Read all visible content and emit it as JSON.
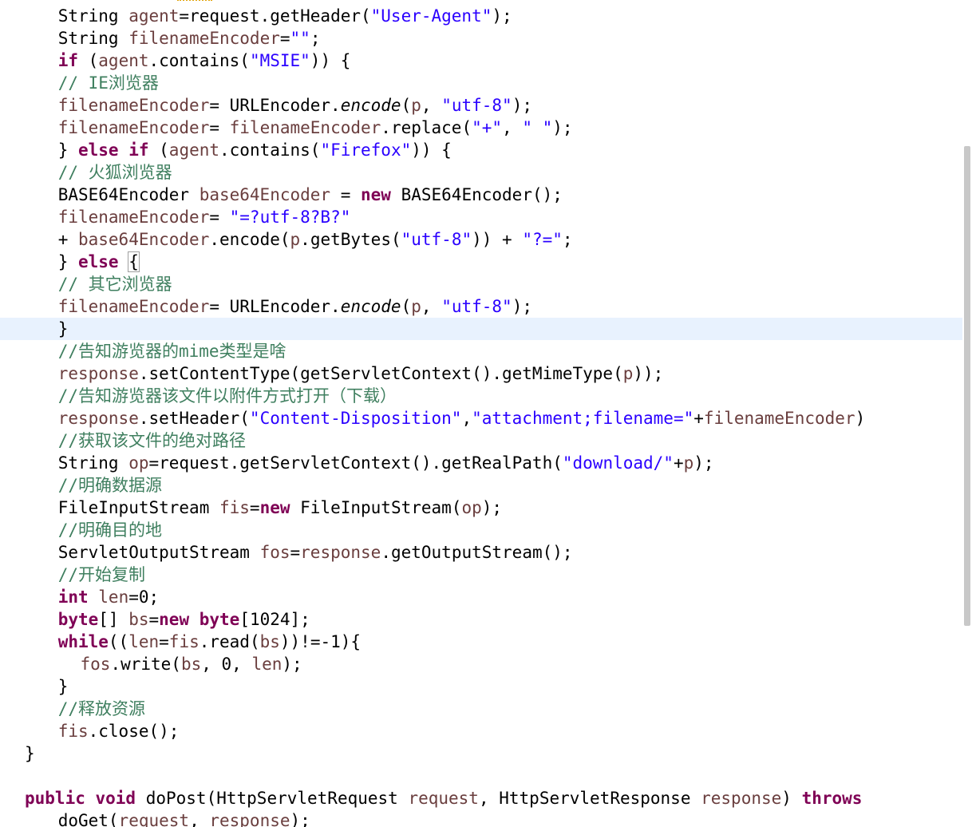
{
  "editor": {
    "lines": [
      {
        "indent": 4,
        "tokens": [
          [
            "plain",
            "String "
          ],
          [
            "field",
            "agent"
          ],
          [
            "plain",
            "=request.getHeader("
          ],
          [
            "string",
            "\"User-Agent\""
          ],
          [
            "plain",
            ");"
          ]
        ]
      },
      {
        "indent": 4,
        "tokens": [
          [
            "plain",
            "String "
          ],
          [
            "field",
            "filenameEncoder"
          ],
          [
            "plain",
            "="
          ],
          [
            "string",
            "\"\""
          ],
          [
            "plain",
            ";"
          ]
        ]
      },
      {
        "indent": 4,
        "tokens": [
          [
            "keyword",
            "if"
          ],
          [
            "plain",
            " ("
          ],
          [
            "field",
            "agent"
          ],
          [
            "plain",
            ".contains("
          ],
          [
            "string",
            "\"MSIE\""
          ],
          [
            "plain",
            ")) {"
          ]
        ]
      },
      {
        "indent": 4,
        "tokens": [
          [
            "comment",
            "// IE浏览器"
          ]
        ]
      },
      {
        "indent": 4,
        "tokens": [
          [
            "field",
            "filenameEncoder"
          ],
          [
            "plain",
            "= URLEncoder."
          ],
          [
            "italic",
            "encode"
          ],
          [
            "plain",
            "("
          ],
          [
            "field",
            "p"
          ],
          [
            "plain",
            ", "
          ],
          [
            "string",
            "\"utf-8\""
          ],
          [
            "plain",
            ");"
          ]
        ]
      },
      {
        "indent": 4,
        "tokens": [
          [
            "field",
            "filenameEncoder"
          ],
          [
            "plain",
            "= "
          ],
          [
            "field",
            "filenameEncoder"
          ],
          [
            "plain",
            ".replace("
          ],
          [
            "string",
            "\"+\""
          ],
          [
            "plain",
            ", "
          ],
          [
            "string",
            "\" \""
          ],
          [
            "plain",
            ");"
          ]
        ]
      },
      {
        "indent": 4,
        "tokens": [
          [
            "plain",
            "} "
          ],
          [
            "keyword",
            "else if"
          ],
          [
            "plain",
            " ("
          ],
          [
            "field",
            "agent"
          ],
          [
            "plain",
            ".contains("
          ],
          [
            "string",
            "\"Firefox\""
          ],
          [
            "plain",
            ")) {"
          ]
        ]
      },
      {
        "indent": 4,
        "tokens": [
          [
            "comment",
            "// 火狐浏览器"
          ]
        ]
      },
      {
        "indent": 4,
        "tokens": [
          [
            "plain",
            "BASE64Encoder "
          ],
          [
            "field",
            "base64Encoder"
          ],
          [
            "plain",
            " = "
          ],
          [
            "keyword",
            "new"
          ],
          [
            "plain",
            " BASE64Encoder();"
          ]
        ]
      },
      {
        "indent": 4,
        "tokens": [
          [
            "field",
            "filenameEncoder"
          ],
          [
            "plain",
            "= "
          ],
          [
            "string",
            "\"=?utf-8?B?\""
          ]
        ]
      },
      {
        "indent": 4,
        "tokens": [
          [
            "plain",
            "+ "
          ],
          [
            "field",
            "base64Encoder"
          ],
          [
            "plain",
            ".encode("
          ],
          [
            "field",
            "p"
          ],
          [
            "plain",
            ".getBytes("
          ],
          [
            "string",
            "\"utf-8\""
          ],
          [
            "plain",
            ")) + "
          ],
          [
            "string",
            "\"?=\""
          ],
          [
            "plain",
            ";"
          ]
        ]
      },
      {
        "indent": 4,
        "tokens": [
          [
            "plain",
            "} "
          ],
          [
            "keyword",
            "else"
          ],
          [
            "plain",
            " "
          ],
          [
            "bracket",
            "{"
          ]
        ]
      },
      {
        "indent": 4,
        "tokens": [
          [
            "comment",
            "// 其它浏览器"
          ]
        ]
      },
      {
        "indent": 4,
        "tokens": [
          [
            "field",
            "filenameEncoder"
          ],
          [
            "plain",
            "= URLEncoder."
          ],
          [
            "italic",
            "encode"
          ],
          [
            "plain",
            "("
          ],
          [
            "field",
            "p"
          ],
          [
            "plain",
            ", "
          ],
          [
            "string",
            "\"utf-8\""
          ],
          [
            "plain",
            ");"
          ]
        ]
      },
      {
        "indent": 4,
        "current": true,
        "tokens": [
          [
            "plain",
            "}"
          ]
        ]
      },
      {
        "indent": 4,
        "tokens": [
          [
            "comment",
            "//告知游览器的mime类型是啥"
          ]
        ]
      },
      {
        "indent": 4,
        "tokens": [
          [
            "field",
            "response"
          ],
          [
            "plain",
            ".setContentType(getServletContext().getMimeType("
          ],
          [
            "field",
            "p"
          ],
          [
            "plain",
            "));"
          ]
        ]
      },
      {
        "indent": 4,
        "tokens": [
          [
            "comment",
            "//告知游览器该文件以附件方式打开（下载）"
          ]
        ]
      },
      {
        "indent": 4,
        "tokens": [
          [
            "field",
            "response"
          ],
          [
            "plain",
            ".setHeader("
          ],
          [
            "string",
            "\"Content-Disposition\""
          ],
          [
            "plain",
            ","
          ],
          [
            "string",
            "\"attachment;filename=\""
          ],
          [
            "plain",
            "+"
          ],
          [
            "field",
            "filenameEncoder"
          ],
          [
            "plain",
            ")"
          ]
        ]
      },
      {
        "indent": 4,
        "tokens": [
          [
            "comment",
            "//获取该文件的绝对路径"
          ]
        ]
      },
      {
        "indent": 4,
        "tokens": [
          [
            "plain",
            "String "
          ],
          [
            "field",
            "op"
          ],
          [
            "plain",
            "=request.getServletContext().getRealPath("
          ],
          [
            "string",
            "\"download/\""
          ],
          [
            "plain",
            "+"
          ],
          [
            "field",
            "p"
          ],
          [
            "plain",
            ");"
          ]
        ]
      },
      {
        "indent": 4,
        "tokens": [
          [
            "comment",
            "//明确数据源"
          ]
        ]
      },
      {
        "indent": 4,
        "tokens": [
          [
            "plain",
            "FileInputStream "
          ],
          [
            "field",
            "fis"
          ],
          [
            "plain",
            "="
          ],
          [
            "keyword",
            "new"
          ],
          [
            "plain",
            " FileInputStream("
          ],
          [
            "field",
            "op"
          ],
          [
            "plain",
            ");"
          ]
        ]
      },
      {
        "indent": 4,
        "tokens": [
          [
            "comment",
            "//明确目的地"
          ]
        ]
      },
      {
        "indent": 4,
        "tokens": [
          [
            "plain",
            "ServletOutputStream "
          ],
          [
            "field",
            "fos"
          ],
          [
            "plain",
            "="
          ],
          [
            "field",
            "response"
          ],
          [
            "plain",
            ".getOutputStream();"
          ]
        ]
      },
      {
        "indent": 4,
        "tokens": [
          [
            "comment",
            "//开始复制"
          ]
        ]
      },
      {
        "indent": 4,
        "tokens": [
          [
            "keyword",
            "int"
          ],
          [
            "plain",
            " "
          ],
          [
            "field",
            "len"
          ],
          [
            "plain",
            "=0;"
          ]
        ]
      },
      {
        "indent": 4,
        "tokens": [
          [
            "keyword",
            "byte"
          ],
          [
            "plain",
            "[] "
          ],
          [
            "field",
            "bs"
          ],
          [
            "plain",
            "="
          ],
          [
            "keyword",
            "new"
          ],
          [
            "plain",
            " "
          ],
          [
            "keyword",
            "byte"
          ],
          [
            "plain",
            "[1024];"
          ]
        ]
      },
      {
        "indent": 4,
        "tokens": [
          [
            "keyword",
            "while"
          ],
          [
            "plain",
            "(("
          ],
          [
            "field",
            "len"
          ],
          [
            "plain",
            "="
          ],
          [
            "field",
            "fis"
          ],
          [
            "plain",
            ".read("
          ],
          [
            "field",
            "bs"
          ],
          [
            "plain",
            "))!=-1){"
          ]
        ]
      },
      {
        "indent": 6,
        "tokens": [
          [
            "field",
            "fos"
          ],
          [
            "plain",
            ".write("
          ],
          [
            "field",
            "bs"
          ],
          [
            "plain",
            ", 0, "
          ],
          [
            "field",
            "len"
          ],
          [
            "plain",
            ");"
          ]
        ]
      },
      {
        "indent": 4,
        "tokens": [
          [
            "plain",
            "}"
          ]
        ]
      },
      {
        "indent": 4,
        "tokens": [
          [
            "comment",
            "//释放资源"
          ]
        ]
      },
      {
        "indent": 4,
        "tokens": [
          [
            "field",
            "fis"
          ],
          [
            "plain",
            ".close();"
          ]
        ]
      },
      {
        "indent": 1,
        "tokens": [
          [
            "plain",
            "}"
          ]
        ]
      },
      {
        "indent": 0,
        "tokens": []
      },
      {
        "indent": 1,
        "tokens": [
          [
            "keyword",
            "public void"
          ],
          [
            "plain",
            " doPost(HttpServletRequest "
          ],
          [
            "field",
            "request"
          ],
          [
            "plain",
            ", HttpServletResponse "
          ],
          [
            "field",
            "response"
          ],
          [
            "plain",
            ") "
          ],
          [
            "keyword",
            "throws"
          ]
        ]
      },
      {
        "indent": 4,
        "tokens": [
          [
            "plain",
            "doGet("
          ],
          [
            "field",
            "request"
          ],
          [
            "plain",
            ", "
          ],
          [
            "field",
            "response"
          ],
          [
            "plain",
            ");"
          ]
        ]
      }
    ]
  },
  "colors": {
    "keyword": "#7f0055",
    "string": "#2a00ff",
    "comment": "#3f7f5f",
    "field": "#6a3e3e",
    "current_line": "#e8f2fe"
  },
  "scrollbar": {
    "position": 0.42,
    "visible_fraction": 0.58
  }
}
